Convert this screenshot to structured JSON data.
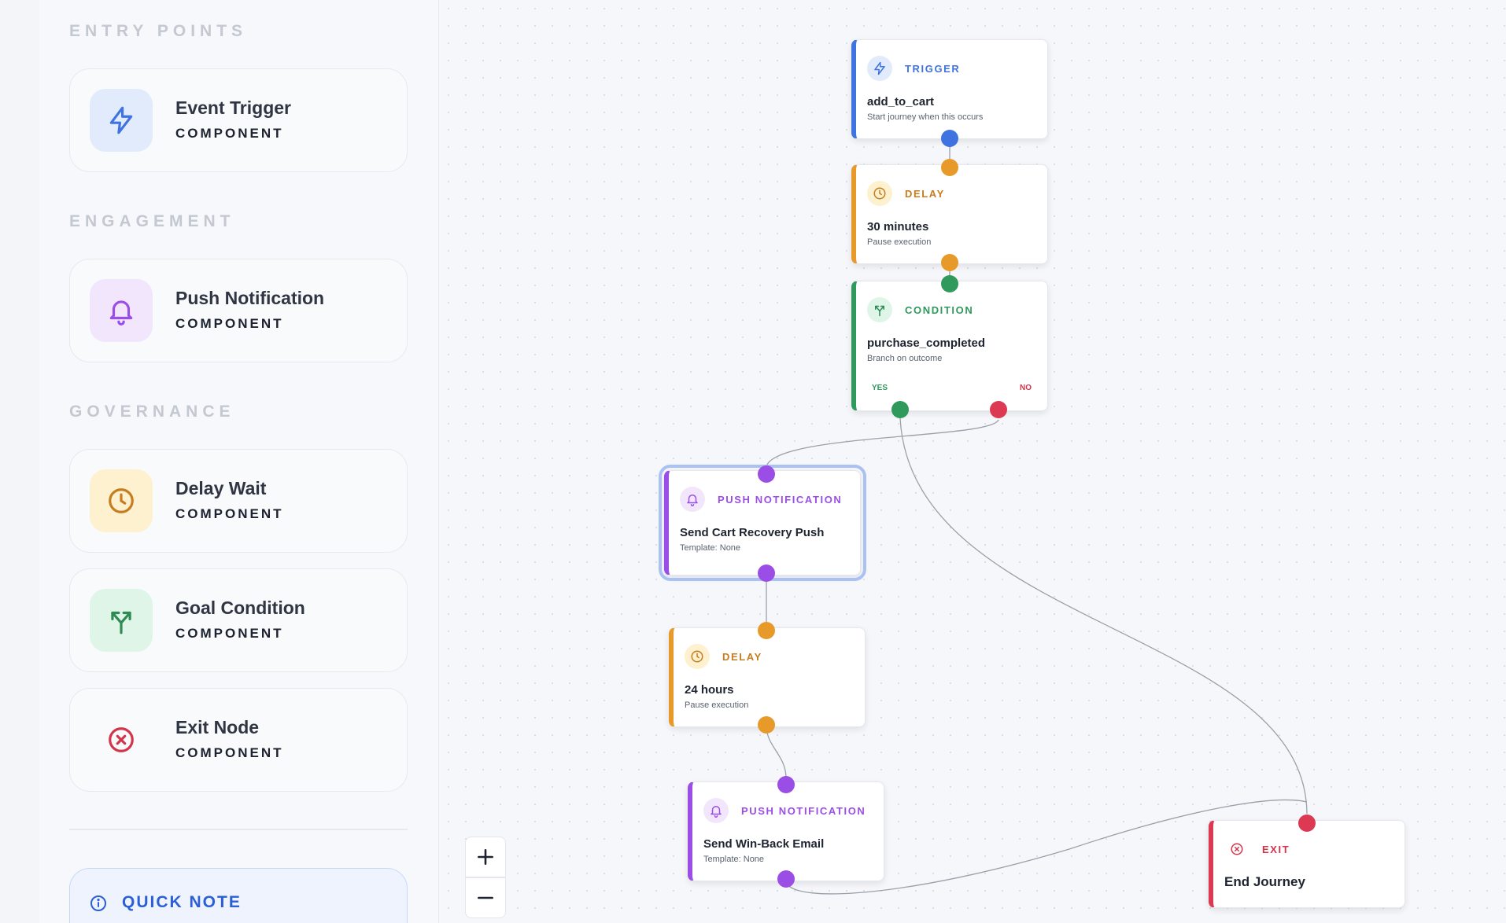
{
  "sidebar": {
    "sections": {
      "entry": "ENTRY POINTS",
      "engagement": "ENGAGEMENT",
      "governance": "GOVERNANCE"
    },
    "components": [
      {
        "name": "Event Trigger",
        "sub": "COMPONENT",
        "icon": "lightning-icon"
      },
      {
        "name": "Push Notification",
        "sub": "COMPONENT",
        "icon": "bell-icon"
      },
      {
        "name": "Delay Wait",
        "sub": "COMPONENT",
        "icon": "clock-icon"
      },
      {
        "name": "Goal Condition",
        "sub": "COMPONENT",
        "icon": "branch-icon"
      },
      {
        "name": "Exit Node",
        "sub": "COMPONENT",
        "icon": "x-circle-icon"
      }
    ],
    "quick_note": {
      "title": "QUICK NOTE",
      "icon": "info-icon"
    }
  },
  "colors": {
    "trigger": "#3f74e0",
    "delay": "#e79a2a",
    "condition": "#2f9a5c",
    "push": "#9b4ee6",
    "exit": "#dc3a52",
    "selected_outline": "#a9c2f3"
  },
  "canvas": {
    "nodes": {
      "trigger": {
        "type": "TRIGGER",
        "title": "add_to_cart",
        "sub": "Start journey when this occurs"
      },
      "delay1": {
        "type": "DELAY",
        "title": "30 minutes",
        "sub": "Pause execution"
      },
      "condition": {
        "type": "CONDITION",
        "title": "purchase_completed",
        "sub": "Branch on outcome",
        "yes": "YES",
        "no": "NO"
      },
      "push1": {
        "type": "PUSH NOTIFICATION",
        "title": "Send Cart Recovery Push",
        "sub": "Template: None"
      },
      "delay2": {
        "type": "DELAY",
        "title": "24 hours",
        "sub": "Pause execution"
      },
      "push2": {
        "type": "PUSH NOTIFICATION",
        "title": "Send Win-Back Email",
        "sub": "Template: None"
      },
      "exit": {
        "type": "EXIT",
        "title": "End Journey"
      }
    },
    "zoom": {
      "in_icon": "plus-icon",
      "out_icon": "minus-icon"
    }
  }
}
